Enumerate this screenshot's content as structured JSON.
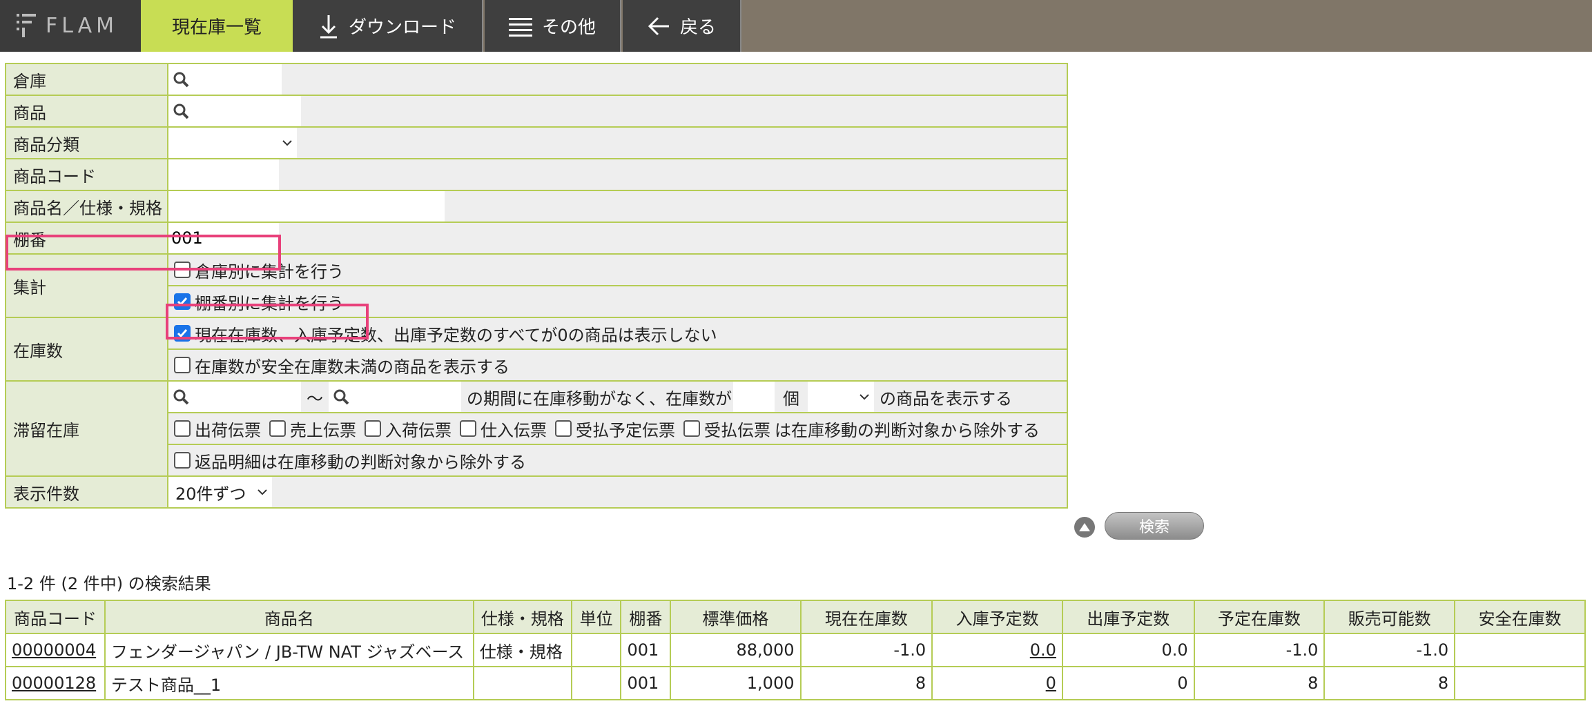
{
  "topbar": {
    "logo": "FLAM",
    "active_tab": "現在庫一覧",
    "download": "ダウンロード",
    "other": "その他",
    "back": "戻る"
  },
  "form": {
    "warehouse_label": "倉庫",
    "product_label": "商品",
    "category_label": "商品分類",
    "code_label": "商品コード",
    "name_label": "商品名／仕様・規格",
    "shelf_label": "棚番",
    "shelf_value": "001",
    "aggregate_label": "集計",
    "agg_by_warehouse": "倉庫別に集計を行う",
    "agg_by_shelf": "棚番別に集計を行う",
    "stock_label": "在庫数",
    "stock_hide_zero": "現在在庫数、入庫予定数、出庫予定数のすべてが0の商品は表示しない",
    "stock_below_safety": "在庫数が安全在庫数未満の商品を表示する",
    "stagnant_label": "滞留在庫",
    "tilde": "〜",
    "period_text": "の期間に在庫移動がなく、在庫数が",
    "unit": "個",
    "show_text": "の商品を表示する",
    "slips": [
      "出荷伝票",
      "売上伝票",
      "入荷伝票",
      "仕入伝票",
      "受払予定伝票",
      "受払伝票"
    ],
    "exclude_text": "は在庫移動の判断対象から除外する",
    "return_exclude": "返品明細は在庫移動の判断対象から除外する",
    "display_count_label": "表示件数",
    "display_count_value": "20件ずつ",
    "search_button": "検索"
  },
  "results": {
    "count_text": "1-2 件 (2 件中) の検索結果",
    "headers": [
      "商品コード",
      "商品名",
      "仕様・規格",
      "単位",
      "棚番",
      "標準価格",
      "現在在庫数",
      "入庫予定数",
      "出庫予定数",
      "予定在庫数",
      "販売可能数",
      "安全在庫数"
    ],
    "rows": [
      [
        "00000004",
        "フェンダージャパン / JB-TW NAT ジャズベース",
        "仕様・規格",
        "",
        "001",
        "88,000",
        "-1.0",
        "0.0",
        "0.0",
        "-1.0",
        "-1.0",
        ""
      ],
      [
        "00000128",
        "テスト商品__1",
        "",
        "",
        "001",
        "1,000",
        "8",
        "0",
        "0",
        "8",
        "8",
        ""
      ]
    ]
  },
  "colors": {
    "accent": "#c8dd54",
    "border": "#b5cc55",
    "label_bg": "#e5ecd6",
    "highlight": "#e8407a"
  }
}
